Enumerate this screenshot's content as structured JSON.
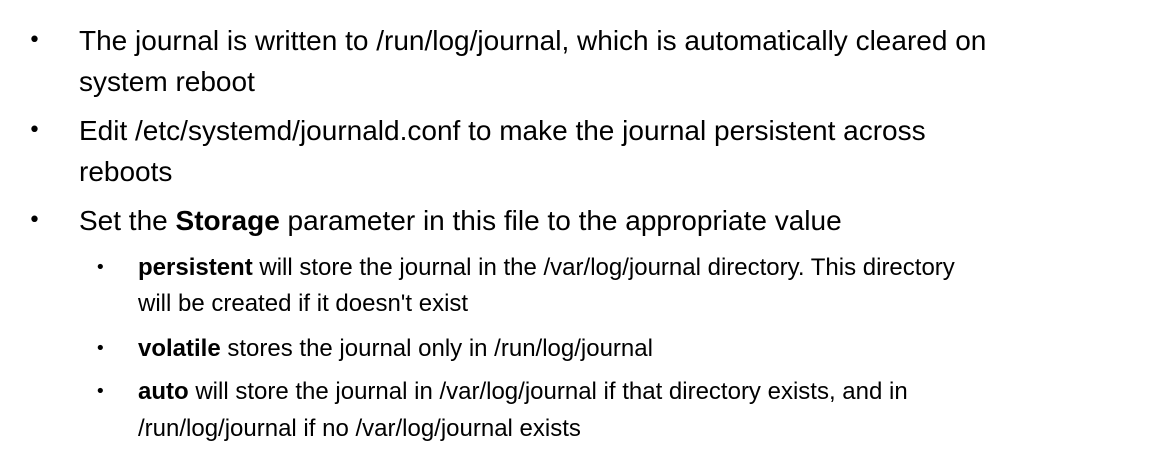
{
  "bullet_glyph": "•",
  "items": [
    {
      "line1": "The journal is written to /run/log/journal, which is automatically cleared on",
      "line2": "system reboot"
    },
    {
      "line1": "Edit /etc/systemd/journald.conf to make the journal persistent across",
      "line2": "reboots"
    },
    {
      "pre": "Set the ",
      "bold": "Storage",
      "post": " parameter in this file to the appropriate value"
    }
  ],
  "subitems": [
    {
      "bold": "persistent",
      "line1_rest": " will store the journal in the /var/log/journal directory. This directory",
      "line2": "will be created if it doesn't exist"
    },
    {
      "bold": "volatile",
      "line1_rest": " stores the journal only in /run/log/journal"
    },
    {
      "bold": "auto",
      "line1_rest": " will store the journal in /var/log/journal if that directory exists, and in",
      "line2": "/run/log/journal if no /var/log/journal exists"
    }
  ]
}
